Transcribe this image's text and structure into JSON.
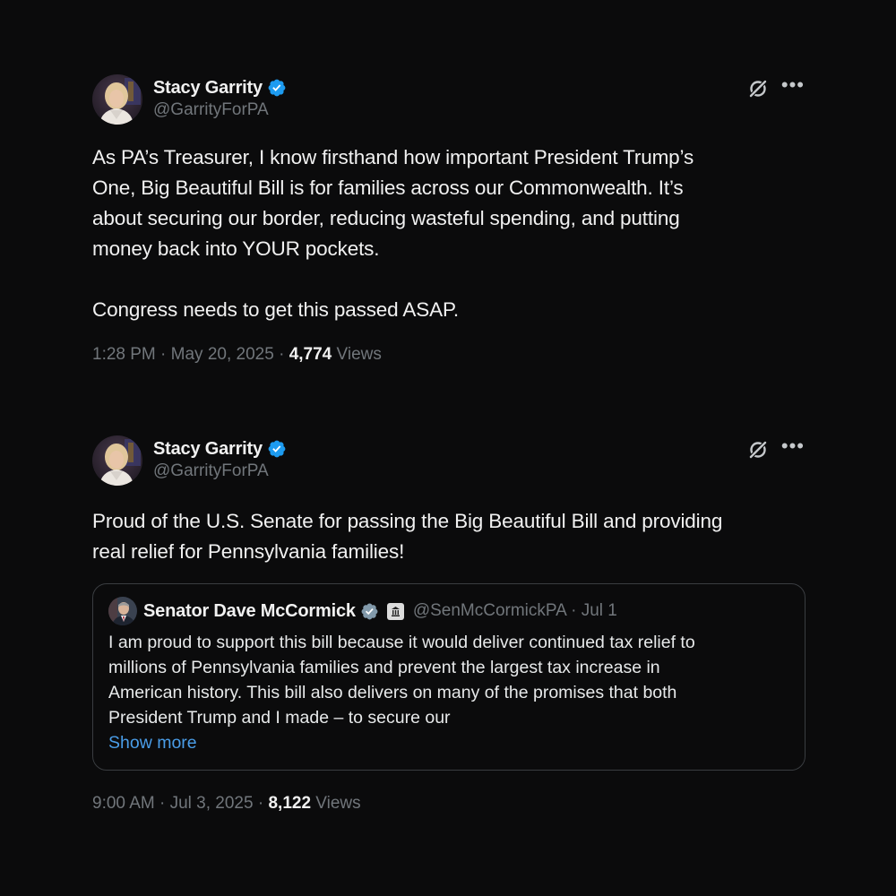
{
  "tweets": [
    {
      "author": {
        "name": "Stacy Garrity",
        "handle": "@GarrityForPA"
      },
      "icons": [
        "verified-badge-icon",
        "grok-icon",
        "more-icon"
      ],
      "text": "As PA’s Treasurer, I know firsthand how important President Trump’s\nOne, Big Beautiful Bill is for families across our Commonwealth. It’s\nabout securing our border, reducing wasteful spending, and putting\nmoney back into YOUR pockets.\n\nCongress needs to get this passed ASAP.",
      "meta": {
        "time": "1:28 PM",
        "date": "May 20, 2025",
        "views_count": "4,774",
        "views_label": "Views"
      }
    },
    {
      "author": {
        "name": "Stacy Garrity",
        "handle": "@GarrityForPA"
      },
      "icons": [
        "verified-badge-icon",
        "grok-icon",
        "more-icon"
      ],
      "text": "Proud of the U.S. Senate for passing the Big Beautiful Bill and providing\nreal relief for Pennsylvania families!",
      "quote": {
        "name": "Senator Dave McCormick",
        "handle": "@SenMcCormickPA",
        "date": "Jul 1",
        "icons": [
          "verified-badge-icon",
          "government-badge-icon"
        ],
        "text": "I am proud to support this bill because it would deliver continued tax relief to\nmillions of Pennsylvania families and prevent the largest tax increase in\nAmerican history. This bill also delivers on many of the promises that both\nPresident Trump and I made – to secure our",
        "show_more": "Show more"
      },
      "meta": {
        "time": "9:00 AM",
        "date": "Jul 3, 2025",
        "views_count": "8,122",
        "views_label": "Views"
      }
    }
  ],
  "colors": {
    "background": "#0b0b0c",
    "text_primary": "#f1f1f1",
    "text_secondary": "#71767b",
    "verified_blue": "#1d9bf0",
    "link_blue": "#4a9de8",
    "border": "#3a3d41"
  }
}
